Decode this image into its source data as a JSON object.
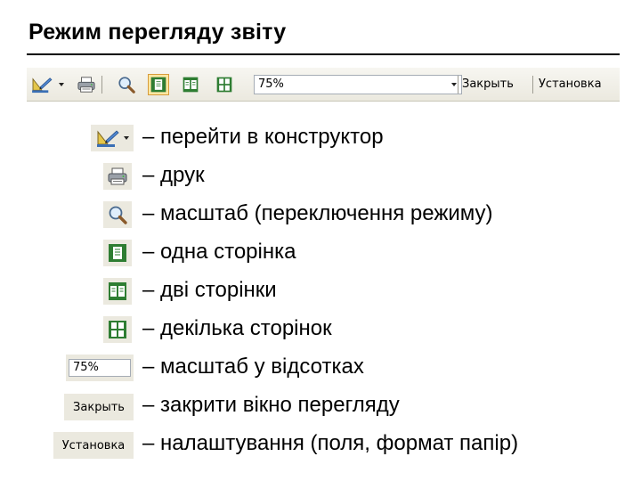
{
  "slide": {
    "title": "Режим перегляду звіту"
  },
  "toolbar": {
    "zoom_value": "75%",
    "close_label": "Закрыть",
    "setup_label": "Установка"
  },
  "legend": [
    {
      "icon": "design-view-icon",
      "text": "– перейти в конструктор"
    },
    {
      "icon": "print-icon",
      "text": "– друк"
    },
    {
      "icon": "zoom-icon",
      "text": "– масштаб (переключення режиму)"
    },
    {
      "icon": "one-page-icon",
      "text": "– одна сторінка"
    },
    {
      "icon": "two-pages-icon",
      "text": "– дві сторінки"
    },
    {
      "icon": "multiple-pages-icon",
      "text": "– декілька сторінок"
    },
    {
      "icon": "zoom-percent-box",
      "sample": "75%",
      "text": "– масштаб у відсотках"
    },
    {
      "icon": "close-button",
      "sample": "Закрыть",
      "text": "– закрити вікно перегляду"
    },
    {
      "icon": "setup-button",
      "sample": "Установка",
      "text": "– налаштування (поля, формат папір)"
    }
  ]
}
